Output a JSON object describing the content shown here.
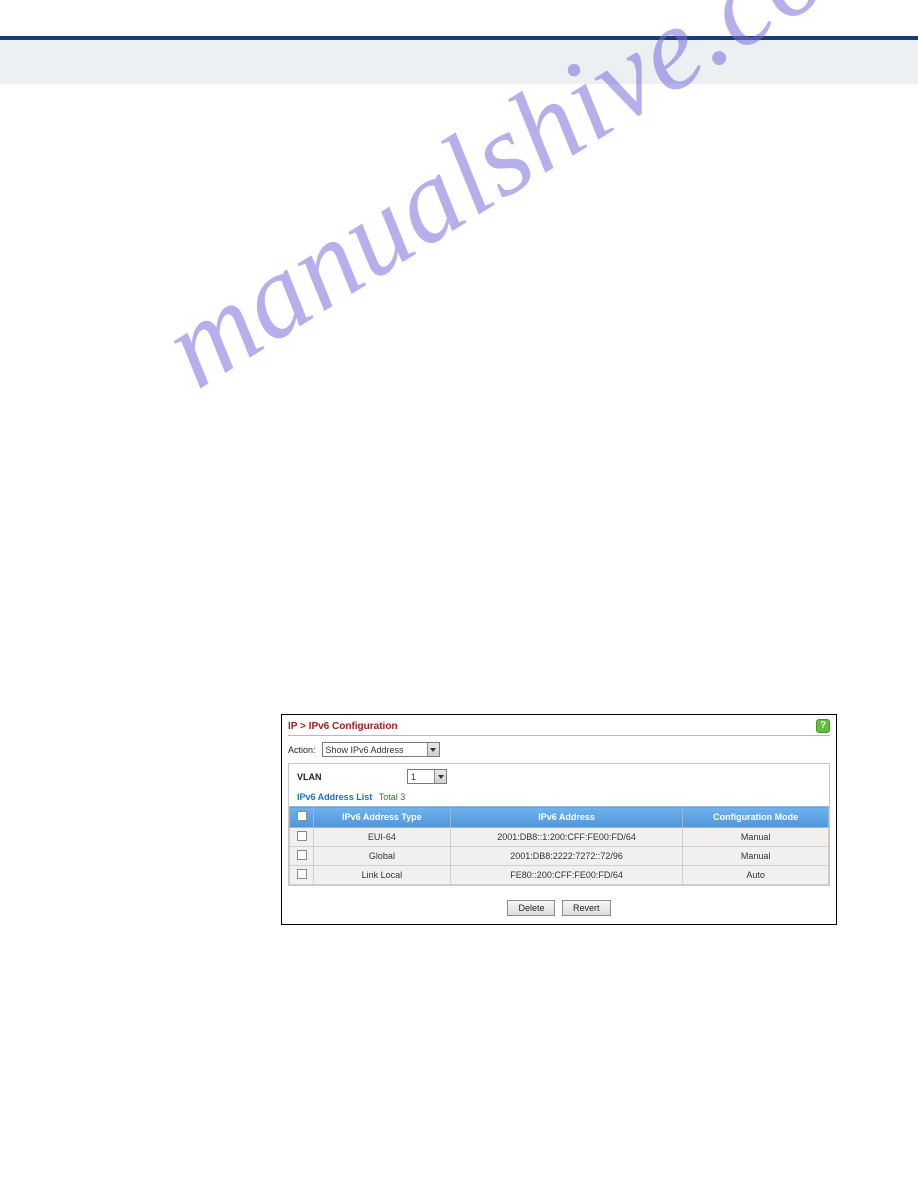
{
  "watermark": "manualshive.com",
  "panel": {
    "title": "IP > IPv6 Configuration",
    "action_label": "Action:",
    "action_value": "Show IPv6 Address",
    "vlan_label": "VLAN",
    "vlan_value": "1",
    "list_title": "IPv6 Address List",
    "list_total": "Total 3",
    "headers": {
      "type": "IPv6 Address Type",
      "addr": "IPv6 Address",
      "mode": "Configuration Mode"
    },
    "rows": [
      {
        "type": "EUI-64",
        "addr": "2001:DB8::1:200:CFF:FE00:FD/64",
        "mode": "Manual"
      },
      {
        "type": "Global",
        "addr": "2001:DB8:2222:7272::72/96",
        "mode": "Manual"
      },
      {
        "type": "Link Local",
        "addr": "FE80::200:CFF:FE00:FD/64",
        "mode": "Auto"
      }
    ],
    "buttons": {
      "delete": "Delete",
      "revert": "Revert"
    },
    "help": "?"
  }
}
